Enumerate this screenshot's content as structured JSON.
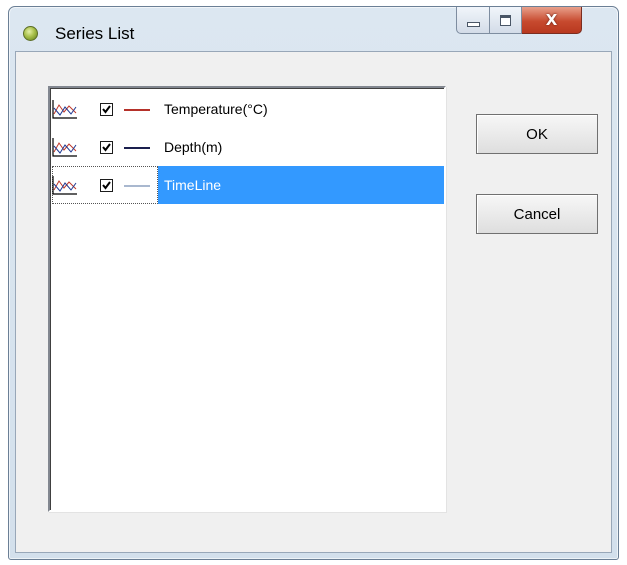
{
  "window": {
    "title": "Series List",
    "app_icon": "green-orb-icon",
    "caption_buttons": {
      "minimize": "minimize-icon",
      "maximize": "maximize-icon",
      "close_label": "X"
    }
  },
  "series_list": {
    "items": [
      {
        "label": "Temperature(°C)",
        "checked": true,
        "line_color": "#b5312a",
        "selected": false
      },
      {
        "label": "Depth(m)",
        "checked": true,
        "line_color": "#1a1f4d",
        "selected": false
      },
      {
        "label": "TimeLine",
        "checked": true,
        "line_color": "#a9b8cf",
        "selected": true
      }
    ],
    "selection_color": "#3399ff"
  },
  "buttons": {
    "ok": "OK",
    "cancel": "Cancel"
  }
}
